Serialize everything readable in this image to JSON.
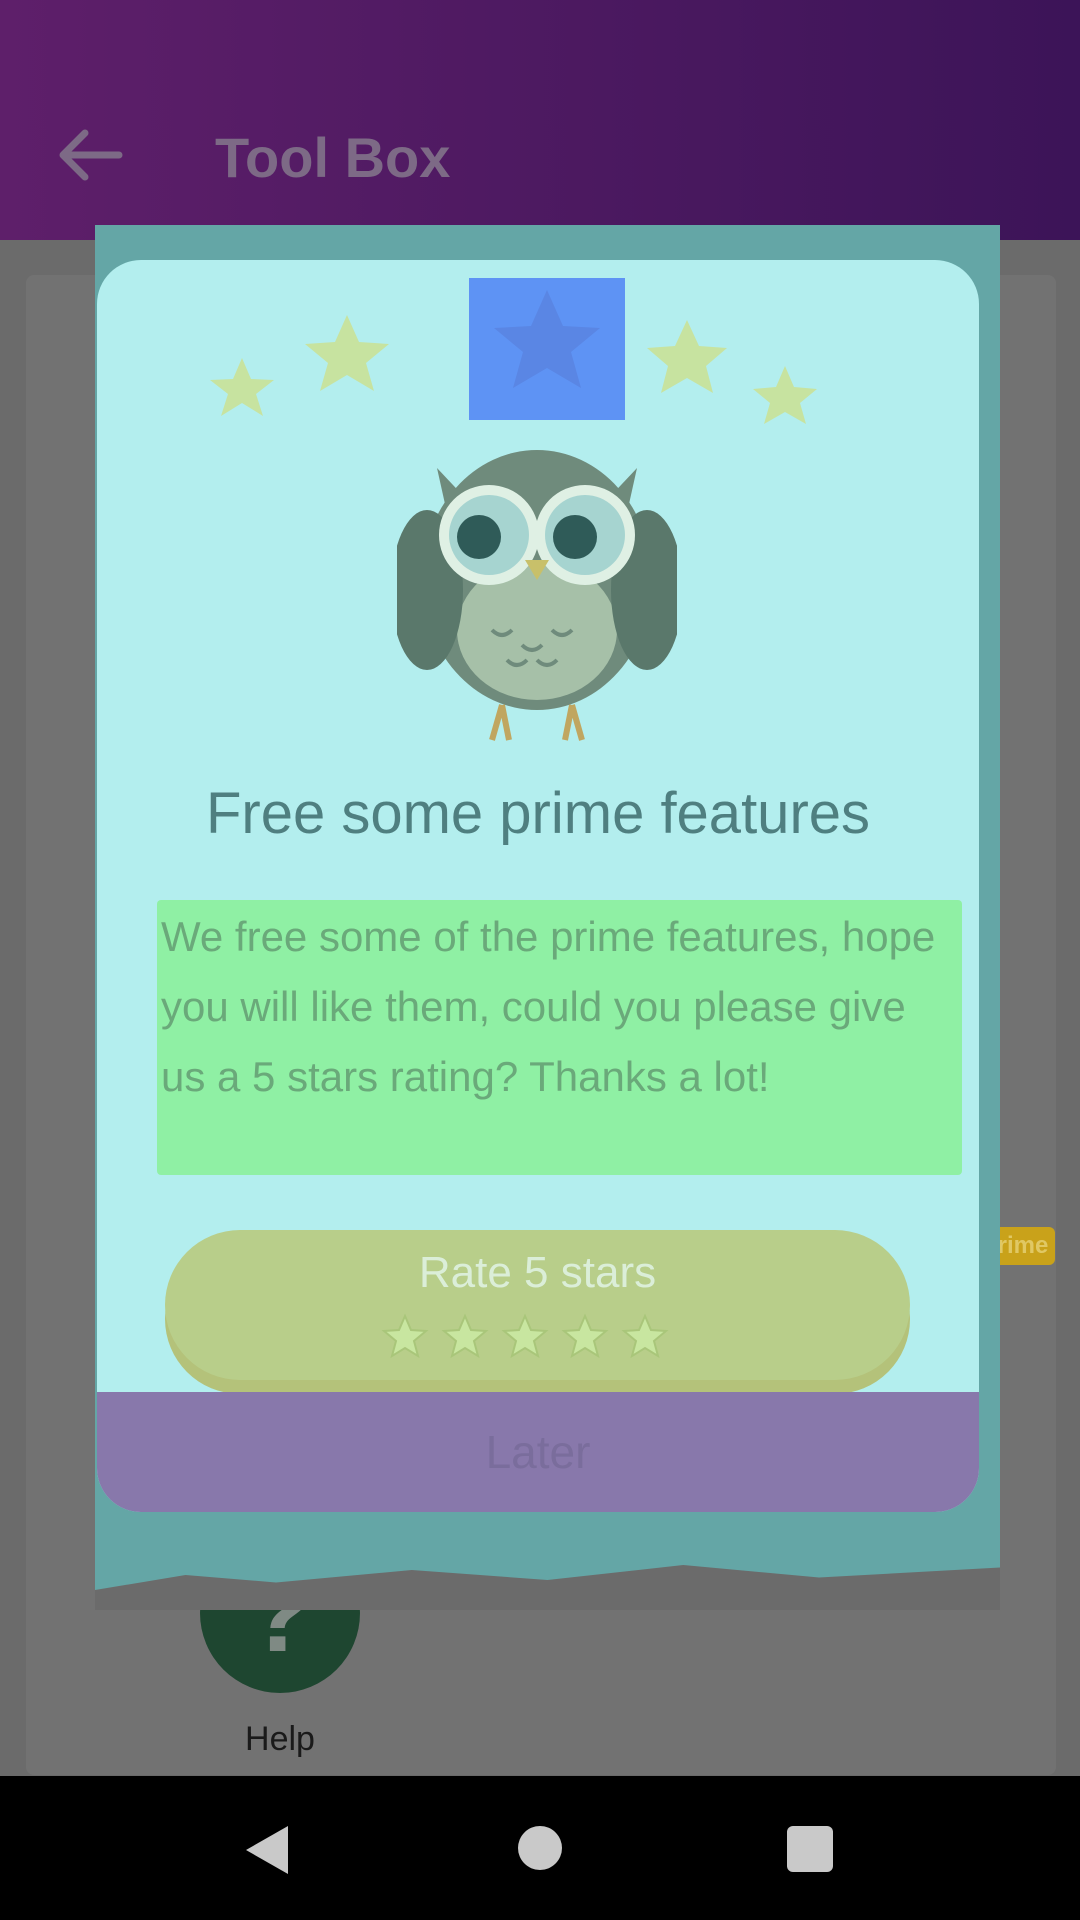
{
  "app_bar": {
    "title": "Tool Box"
  },
  "background": {
    "badge_text": "Prime",
    "help_label": "Help",
    "help_glyph": "?"
  },
  "dialog": {
    "title": "Free some prime features",
    "message": "We free some of the prime features, hope you will like them, could you please give us a 5 stars rating? Thanks a lot!",
    "rate_button_label": "Rate 5 stars",
    "rate_star_count": 5,
    "later_button_label": "Later"
  },
  "colors": {
    "app_bar_start": "#5e1f6a",
    "app_bar_end": "#3c1458",
    "dialog_bg": "#b3eeee",
    "rate_button": "#b8ce8a",
    "later_button": "#8878ab",
    "message_highlight": "#8ff0a4"
  },
  "icons": {
    "back": "arrow-left-icon",
    "featured_star": "star-icon",
    "owl": "owl-mascot",
    "help": "question-icon",
    "nav_back": "triangle-back-icon",
    "nav_home": "circle-home-icon",
    "nav_recent": "square-recents-icon"
  }
}
